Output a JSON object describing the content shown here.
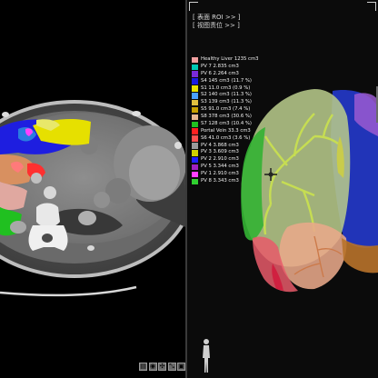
{
  "menu": {
    "item1": "[ 表面 ROI >> ]",
    "item2": "[ 视图责位 >> ]"
  },
  "legend": [
    {
      "color": "#f2a0a0",
      "label": "Healthy Liver 1235 cm3"
    },
    {
      "color": "#00c8b4",
      "label": "PV 7   2.835 cm3"
    },
    {
      "color": "#7a2ad8",
      "label": "PV 6   2.264 cm3"
    },
    {
      "color": "#1a1ae0",
      "label": "S4   145 cm3 (11.7 %)"
    },
    {
      "color": "#e8e000",
      "label": "S1   11.0 cm3 (0.9 %)"
    },
    {
      "color": "#4aa0ff",
      "label": "S2   140 cm3 (11.3 %)"
    },
    {
      "color": "#e0c040",
      "label": "S3   139 cm3 (11.3 %)"
    },
    {
      "color": "#c8a000",
      "label": "S5   91.0 cm3 (7.4 %)"
    },
    {
      "color": "#e8b890",
      "label": "S8   378 cm3 (30.6 %)"
    },
    {
      "color": "#20c020",
      "label": "S7   128 cm3 (10.4 %)"
    },
    {
      "color": "#ff2020",
      "label": "Portal Vein   33.3 cm3"
    },
    {
      "color": "#ff5050",
      "label": "S6   41.0 cm3 (3.6 %)"
    },
    {
      "color": "#9a9a9a",
      "label": "PV 4   3.868 cm3"
    },
    {
      "color": "#d0d000",
      "label": "PV 3   3.609 cm3"
    },
    {
      "color": "#2020ff",
      "label": "PV 2   2.910 cm3"
    },
    {
      "color": "#a020c0",
      "label": "PV 5   3.344 cm3"
    },
    {
      "color": "#ff40ff",
      "label": "PV 1   2.910 cm3"
    },
    {
      "color": "#30d030",
      "label": "PV 8   3.343 cm3"
    }
  ],
  "toolbar": {
    "btn1": "▤",
    "btn2": "◉",
    "btn3": "✣",
    "btn4": "⤡",
    "btn5": "▣"
  }
}
